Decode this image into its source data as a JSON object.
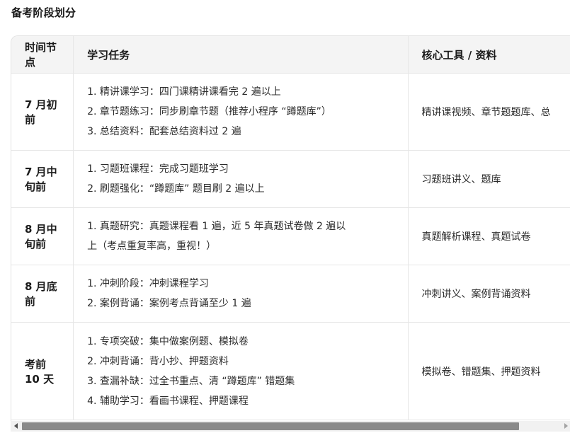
{
  "section_title": "备考阶段划分",
  "table": {
    "headers": [
      "时间节点",
      "学习任务",
      "核心工具 / 资料"
    ],
    "rows": [
      {
        "time": "7 月初前",
        "tasks": [
          "1. 精讲课学习：四门课精讲课看完 2 遍以上",
          "2. 章节题练习：同步刷章节题（推荐小程序 “蹲题库”）",
          "3. 总结资料：配套总结资料过 2 遍"
        ],
        "tools": "精讲课视频、章节题题库、总"
      },
      {
        "time": "7 月中旬前",
        "tasks": [
          "1. 习题班课程：完成习题班学习",
          "2. 刷题强化：“蹲题库” 题目刷 2 遍以上"
        ],
        "tools": "习题班讲义、题库"
      },
      {
        "time": "8 月中旬前",
        "tasks": [
          "1. 真题研究：真题课程看 1 遍，近 5 年真题试卷做 2 遍以",
          "上（考点重复率高，重视！）"
        ],
        "tools": "真题解析课程、真题试卷"
      },
      {
        "time": "8 月底前",
        "tasks": [
          "1. 冲刺阶段：冲刺课程学习",
          "2. 案例背诵：案例考点背诵至少 1 遍"
        ],
        "tools": "冲刺讲义、案例背诵资料"
      },
      {
        "time": "考前 10 天",
        "tasks": [
          "1. 专项突破：集中做案例题、模拟卷",
          "2. 冲刺背诵：背小抄、押题资料",
          "3. 查漏补缺：过全书重点、清 “蹲题库” 错题集",
          "4. 辅助学习：看画书课程、押题课程"
        ],
        "tools": "模拟卷、错题集、押题资料"
      }
    ]
  },
  "scrollbar": {
    "position_fraction": 0.0,
    "visible_fraction": 0.78
  }
}
